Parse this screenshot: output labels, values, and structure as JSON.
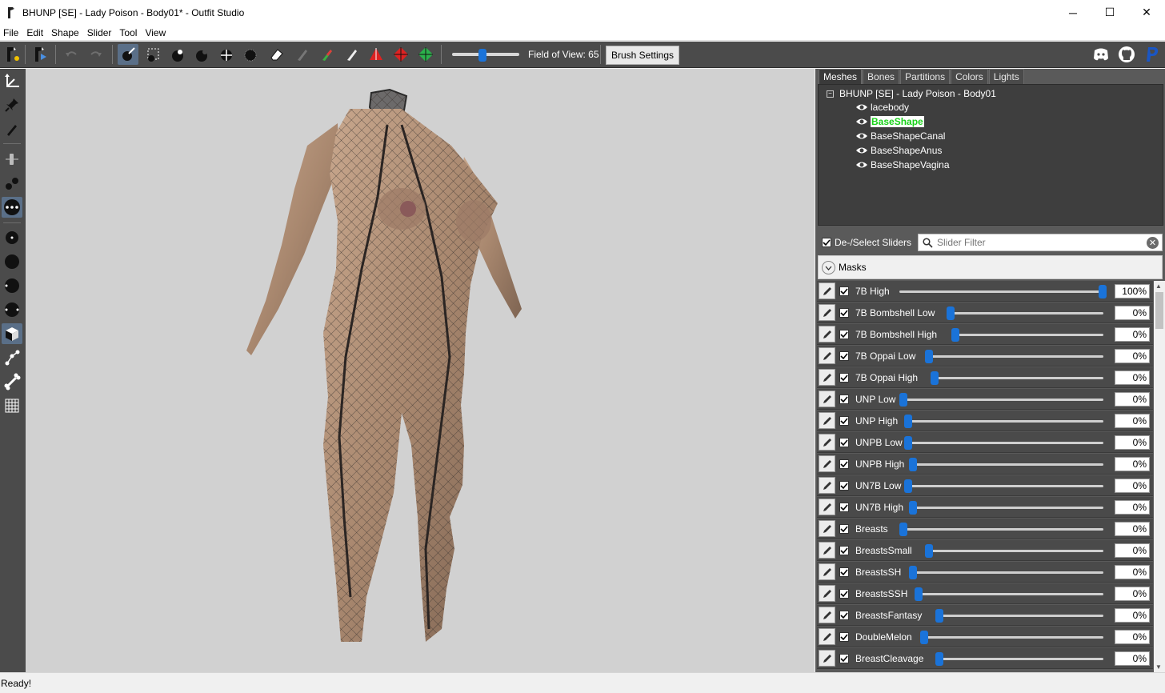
{
  "window": {
    "title": "BHUNP [SE] - Lady Poison - Body01* - Outfit Studio",
    "minimize": "─",
    "maximize": "☐",
    "close": "✕"
  },
  "menu": [
    "File",
    "Edit",
    "Shape",
    "Slider",
    "Tool",
    "View"
  ],
  "toolbar": {
    "fov_label": "Field of View: 65",
    "fov_value": 65,
    "brush_settings_label": "Brush Settings",
    "icons": [
      "new-project-icon",
      "load-reference-icon",
      "undo-icon",
      "redo-icon",
      "select-brush-icon",
      "mask-brush-icon",
      "inflate-brush-icon",
      "deflate-brush-icon",
      "move-brush-icon",
      "smooth-brush-icon",
      "undiff-brush-icon",
      "weight-brush-icon",
      "color-brush-icon",
      "alpha-brush-icon",
      "transform-icon",
      "pivot-icon",
      "vertex-select-icon"
    ],
    "right_icons": [
      "discord-icon",
      "github-icon",
      "paypal-icon"
    ]
  },
  "leftbar": {
    "icons": [
      "transform-tool-icon",
      "pin-tool-icon",
      "pencil-tool-icon",
      "slider-tool-icon",
      "vertex-tool-icon",
      "dots-tool-icon",
      "small-brush-icon",
      "large-brush-icon",
      "medium-brush-icon",
      "smooth-brush-icon",
      "cube-tool-icon",
      "edge-tool-icon",
      "bone-tool-icon",
      "grid-tool-icon"
    ]
  },
  "panel": {
    "tabs": [
      "Meshes",
      "Bones",
      "Partitions",
      "Colors",
      "Lights"
    ],
    "active_tab": "Meshes",
    "tree_root": "BHUNP [SE] - Lady Poison - Body01",
    "tree_collapse": "−",
    "meshes": [
      "lacebody",
      "BaseShape",
      "BaseShapeCanal",
      "BaseShapeAnus",
      "BaseShapeVagina"
    ],
    "selected_mesh": "BaseShape"
  },
  "filter": {
    "deselect_label": "De-/Select Sliders",
    "placeholder": "Slider Filter",
    "clear": "✕"
  },
  "masks_label": "Masks",
  "sliders": [
    {
      "name": "7B High",
      "percent": 100,
      "value": "100%"
    },
    {
      "name": "7B Bombshell Low",
      "percent": 0,
      "value": "0%"
    },
    {
      "name": "7B Bombshell High",
      "percent": 0,
      "value": "0%"
    },
    {
      "name": "7B Oppai Low",
      "percent": 0,
      "value": "0%"
    },
    {
      "name": "7B Oppai High",
      "percent": 0,
      "value": "0%"
    },
    {
      "name": "UNP Low",
      "percent": 0,
      "value": "0%"
    },
    {
      "name": "UNP High",
      "percent": 0,
      "value": "0%"
    },
    {
      "name": "UNPB Low",
      "percent": 0,
      "value": "0%"
    },
    {
      "name": "UNPB High",
      "percent": 0,
      "value": "0%"
    },
    {
      "name": "UN7B Low",
      "percent": 0,
      "value": "0%"
    },
    {
      "name": "UN7B High",
      "percent": 0,
      "value": "0%"
    },
    {
      "name": "Breasts",
      "percent": 0,
      "value": "0%"
    },
    {
      "name": "BreastsSmall",
      "percent": 0,
      "value": "0%"
    },
    {
      "name": "BreastsSH",
      "percent": 0,
      "value": "0%"
    },
    {
      "name": "BreastsSSH",
      "percent": 0,
      "value": "0%"
    },
    {
      "name": "BreastsFantasy",
      "percent": 0,
      "value": "0%"
    },
    {
      "name": "DoubleMelon",
      "percent": 0,
      "value": "0%"
    },
    {
      "name": "BreastCleavage",
      "percent": 0,
      "value": "0%"
    }
  ],
  "status": "Ready!",
  "colors": {
    "accent": "#1a73d9",
    "selected_mesh_text": "#19d119",
    "dark_panel": "#4b4b4b",
    "viewport_bg": "#d1d1d1"
  }
}
